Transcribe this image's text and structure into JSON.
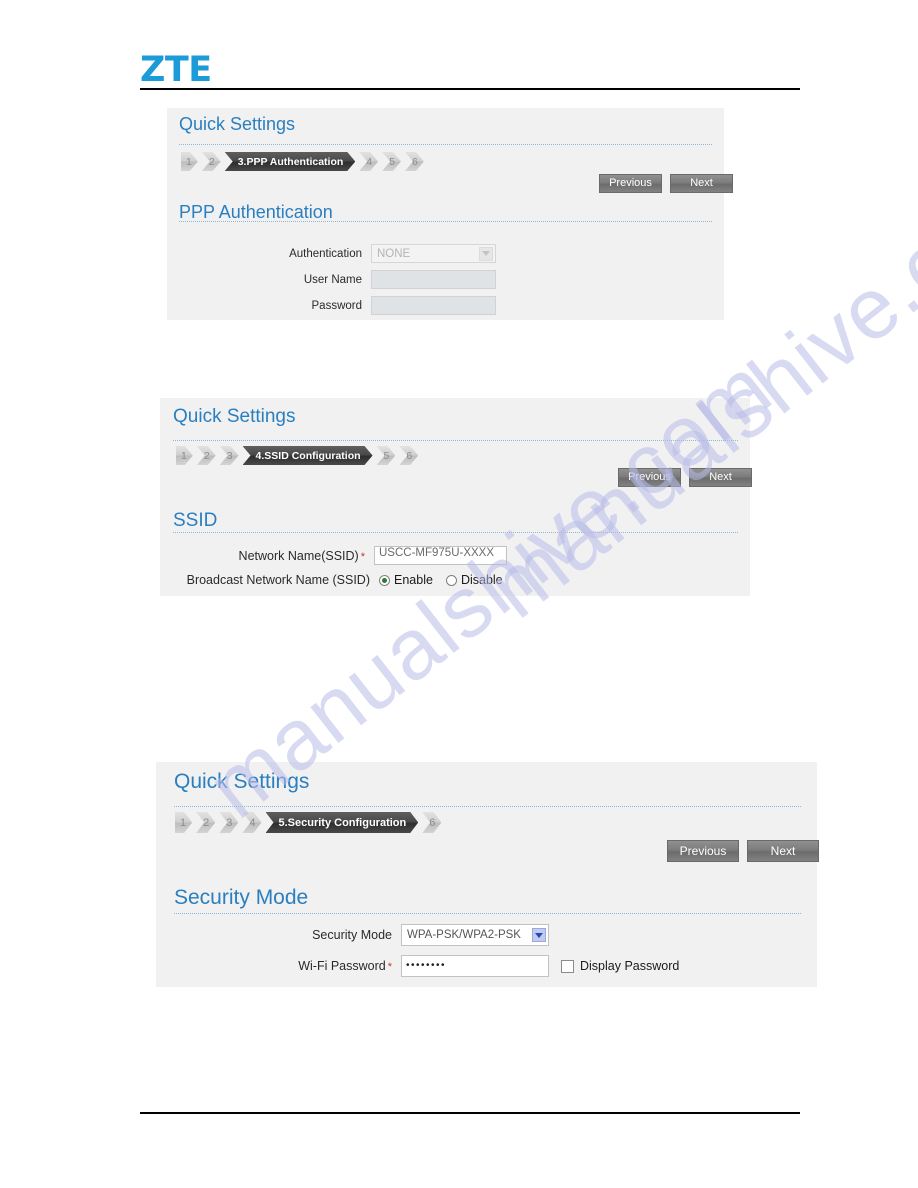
{
  "brand": {
    "logo_text": "ZTE"
  },
  "watermark": {
    "text_a": "manualshive.com",
    "text_b": "manualshive.com",
    "color": "#b9bce8"
  },
  "theme": {
    "heading_color": "#2a7fc0",
    "panel_bg": "#f1f1f1",
    "logo_color": "#1b9bd8",
    "active_step_bg": "#3a3a3a",
    "required_star_color": "#c0392b",
    "radio_on_color": "#2a7a35",
    "select_arrow_color": "#2a49a8"
  },
  "panels": [
    {
      "title": "Quick Settings",
      "section_title": "PPP Authentication",
      "steps": [
        {
          "label": "1",
          "active": false
        },
        {
          "label": "2",
          "active": false
        },
        {
          "label": "3.PPP Authentication",
          "active": true
        },
        {
          "label": "4",
          "active": false
        },
        {
          "label": "5",
          "active": false
        },
        {
          "label": "6",
          "active": false
        }
      ],
      "buttons": {
        "previous": "Previous",
        "next": "Next"
      },
      "fields": {
        "authentication_label": "Authentication",
        "authentication_value": "NONE",
        "username_label": "User Name",
        "username_value": "",
        "password_label": "Password",
        "password_value": ""
      }
    },
    {
      "title": "Quick Settings",
      "section_title": "SSID",
      "steps": [
        {
          "label": "1",
          "active": false
        },
        {
          "label": "2",
          "active": false
        },
        {
          "label": "3",
          "active": false
        },
        {
          "label": "4.SSID Configuration",
          "active": true
        },
        {
          "label": "5",
          "active": false
        },
        {
          "label": "6",
          "active": false
        }
      ],
      "buttons": {
        "previous": "Previous",
        "next": "Next"
      },
      "fields": {
        "network_name_label": "Network Name(SSID)",
        "network_name_value": "USCC-MF975U-XXXX",
        "broadcast_label": "Broadcast Network Name (SSID)",
        "broadcast_enable": "Enable",
        "broadcast_disable": "Disable",
        "broadcast_selected": "Enable"
      }
    },
    {
      "title": "Quick Settings",
      "section_title": "Security Mode",
      "steps": [
        {
          "label": "1",
          "active": false
        },
        {
          "label": "2",
          "active": false
        },
        {
          "label": "3",
          "active": false
        },
        {
          "label": "4",
          "active": false
        },
        {
          "label": "5.Security Configuration",
          "active": true
        },
        {
          "label": "6",
          "active": false
        }
      ],
      "buttons": {
        "previous": "Previous",
        "next": "Next"
      },
      "fields": {
        "security_mode_label": "Security Mode",
        "security_mode_value": "WPA-PSK/WPA2-PSK",
        "wifi_password_label": "Wi-Fi Password",
        "wifi_password_value": "••••••••",
        "display_password_label": "Display Password",
        "display_password_checked": false
      }
    }
  ]
}
